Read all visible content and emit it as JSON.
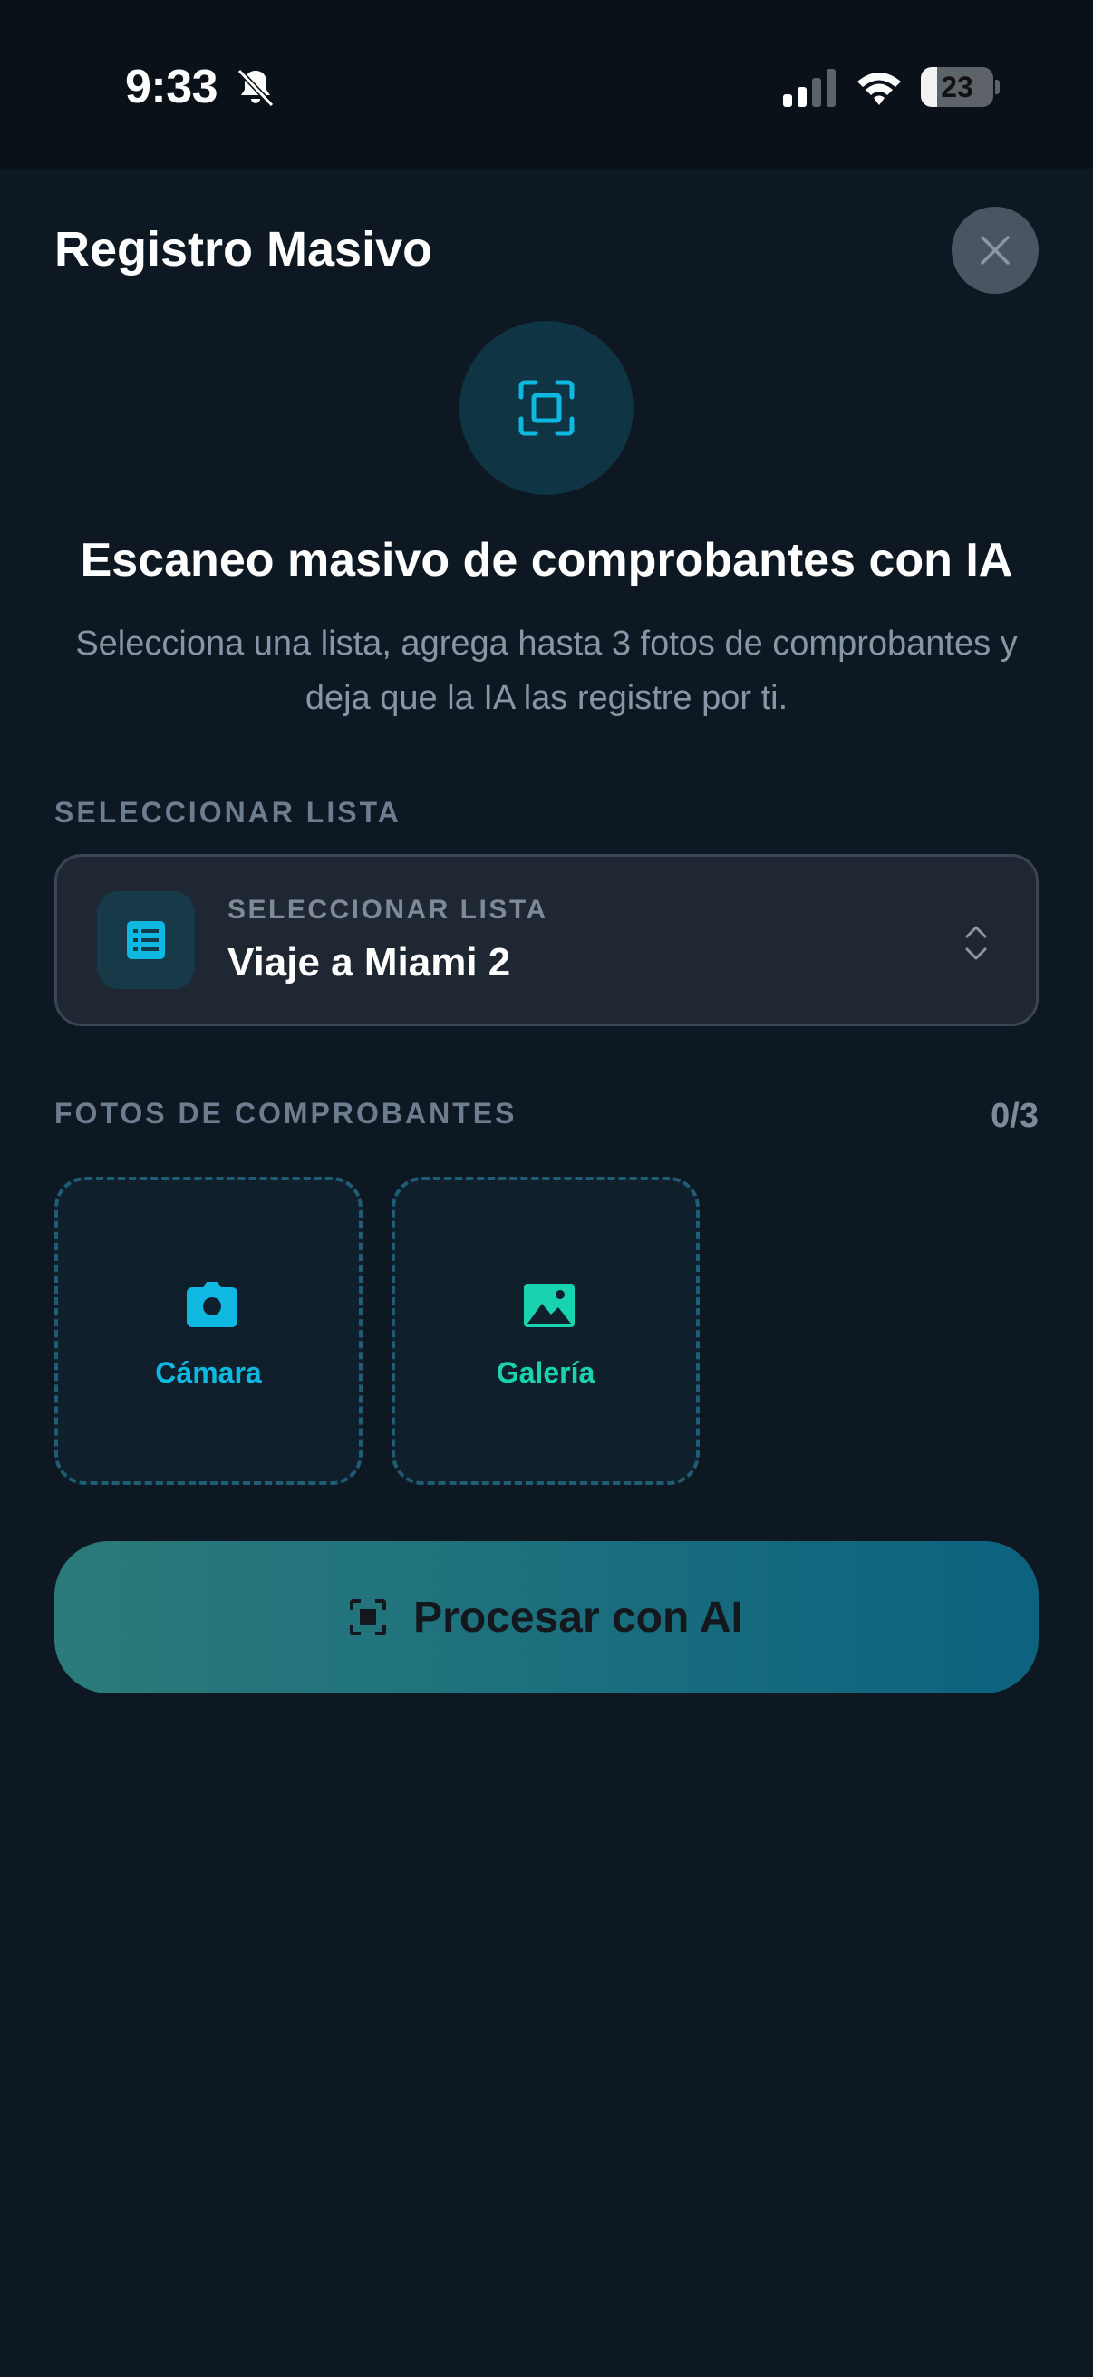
{
  "status_bar": {
    "time": "9:33",
    "battery": "23",
    "battery_level": 0.23
  },
  "sheet": {
    "title": "Registro Masivo",
    "headline": "Escaneo masivo de comprobantes con IA",
    "subtitle": "Selecciona una lista, agrega hasta 3 fotos de comprobantes y deja que la IA las registre por ti."
  },
  "list_section": {
    "label": "SELECCIONAR LISTA",
    "select_label": "SELECCIONAR LISTA",
    "select_value": "Viaje a Miami 2"
  },
  "photos_section": {
    "label": "FOTOS DE COMPROBANTES",
    "count": "0/3",
    "camera_label": "Cámara",
    "gallery_label": "Galería"
  },
  "process_button": {
    "label": "Procesar con AI"
  },
  "colors": {
    "accent_cyan": "#0fb8e0",
    "accent_teal": "#19d3b0",
    "background": "#0e1822"
  },
  "icons": {
    "close": "close-icon",
    "scan": "scan-icon",
    "list": "list-icon",
    "camera": "camera-icon",
    "gallery": "image-icon"
  }
}
